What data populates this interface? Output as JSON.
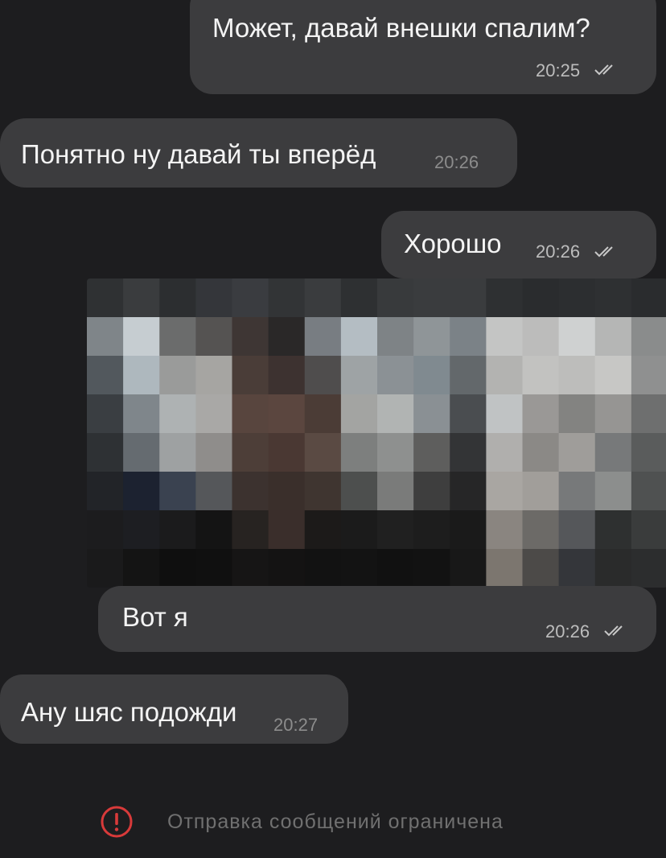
{
  "messages": [
    {
      "text": "Может, давай внешки спалим?",
      "time": "20:25",
      "direction": "outgoing",
      "status": "read"
    },
    {
      "text": "Понятно ну давай ты вперёд",
      "time": "20:26",
      "direction": "incoming"
    },
    {
      "text": "Хорошо",
      "time": "20:26",
      "direction": "outgoing",
      "status": "read"
    },
    {
      "text": "Вот я",
      "time": "20:26",
      "direction": "outgoing",
      "status": "read",
      "attachment": "pixelated-photo"
    },
    {
      "text": "Ану шяс подожди",
      "time": "20:27",
      "direction": "incoming"
    }
  ],
  "notice": {
    "icon": "alert-circle-icon",
    "text": "Отправка сообщений ограничена",
    "icon_color": "#d83a3a"
  },
  "colors": {
    "background": "#1d1d1f",
    "bubble": "#3c3c3e",
    "text": "#f4f4f4",
    "time": "#bdbdbd"
  }
}
